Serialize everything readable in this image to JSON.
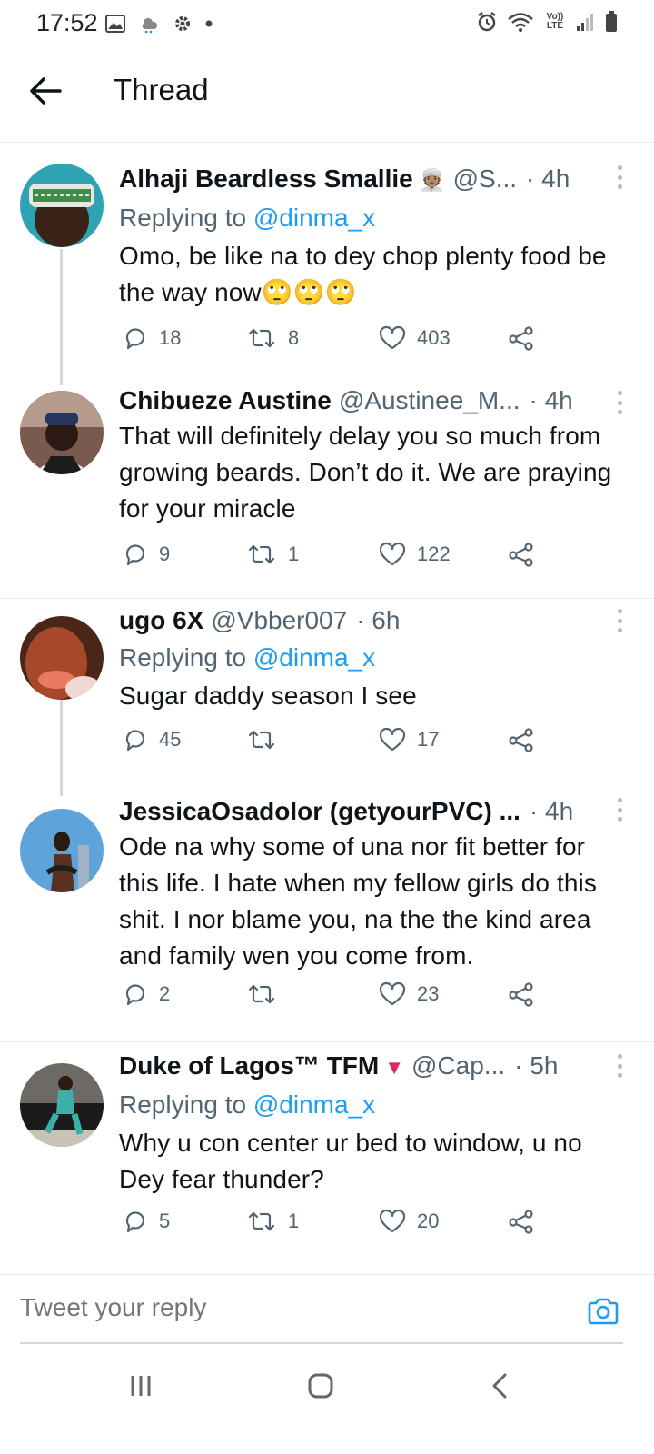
{
  "status_bar": {
    "time": "17:52",
    "network": "Vo)) LTE"
  },
  "header": {
    "title": "Thread"
  },
  "tweets": [
    {
      "name": "Alhaji Beardless Smallie",
      "emoji": "👳🏽",
      "handle": "@S...",
      "time": "· 4h",
      "replying_prefix": "Replying to ",
      "replying_handle": "@dinma_x",
      "text": "Omo, be like na to dey chop plenty food be the way now🙄🙄🙄",
      "replies": "18",
      "retweets": "8",
      "likes": "403"
    },
    {
      "name": "Chibueze Austine",
      "handle": "@Austinee_M...",
      "time": "· 4h",
      "text": "That will definitely delay you so much from growing beards. Don’t do it. We are praying for your miracle",
      "replies": "9",
      "retweets": "1",
      "likes": "122"
    },
    {
      "name": "ugo 6X",
      "handle": "@Vbber007",
      "time": "· 6h",
      "replying_prefix": "Replying to ",
      "replying_handle": "@dinma_x",
      "text": "Sugar daddy season I see",
      "replies": "45",
      "retweets": "",
      "likes": "17"
    },
    {
      "name": "JessicaOsadolor (getyourPVC) ...",
      "handle": "",
      "time": "· 4h",
      "text": "Ode na why some of una nor fit better for this life. I hate when my fellow girls do this shit. I nor blame you, na the the kind area and family wen you come from.",
      "replies": "2",
      "retweets": "",
      "likes": "23"
    },
    {
      "name": "Duke of Lagos™ TFM",
      "badge": "▼",
      "handle": "@Cap...",
      "time": "· 5h",
      "replying_prefix": "Replying to ",
      "replying_handle": "@dinma_x",
      "text": "Why u con center ur bed to window, u no Dey fear thunder?",
      "replies": "5",
      "retweets": "1",
      "likes": "20"
    }
  ],
  "compose": {
    "placeholder": "Tweet your reply"
  },
  "colors": {
    "accent": "#1d9bf0",
    "secondary_text": "#536471",
    "badge_red": "#e0245e"
  }
}
